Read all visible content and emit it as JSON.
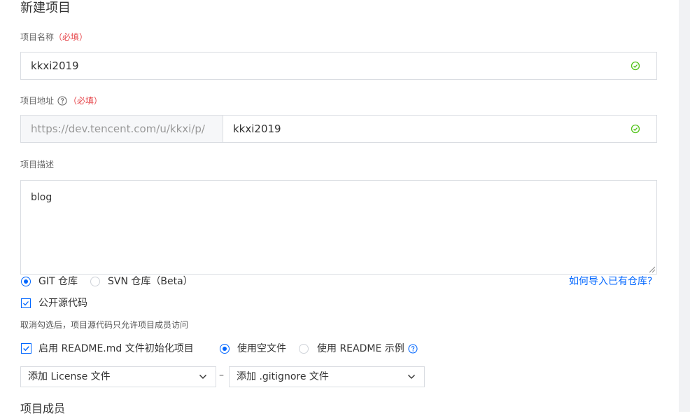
{
  "page": {
    "title": "新建项目"
  },
  "name_field": {
    "label": "项目名称",
    "required": "（必填）",
    "value": "kkxi2019"
  },
  "address_field": {
    "label": "项目地址",
    "required": "（必填）",
    "prefix": "https://dev.tencent.com/u/kkxi/p/",
    "value": "kkxi2019"
  },
  "description_field": {
    "label": "项目描述",
    "value": "blog"
  },
  "repo_type": {
    "options": [
      "GIT 仓库",
      "SVN 仓库（Beta）"
    ],
    "selected": "GIT 仓库",
    "import_link": "如何导入已有仓库?"
  },
  "open_source": {
    "label": "公开源代码",
    "checked": true,
    "hint": "取消勾选后，项目源代码只允许项目成员访问"
  },
  "readme": {
    "label": "启用 README.md 文件初始化项目",
    "checked": true,
    "options": [
      "使用空文件",
      "使用 README 示例"
    ],
    "selected": "使用空文件"
  },
  "license_select": {
    "value": "添加 License 文件"
  },
  "separator": "–",
  "gitignore_select": {
    "value": "添加 .gitignore 文件"
  },
  "members_section": {
    "title": "项目成员"
  },
  "colors": {
    "accent": "#0066ff",
    "success": "#52c41a",
    "required": "#e6454a"
  }
}
